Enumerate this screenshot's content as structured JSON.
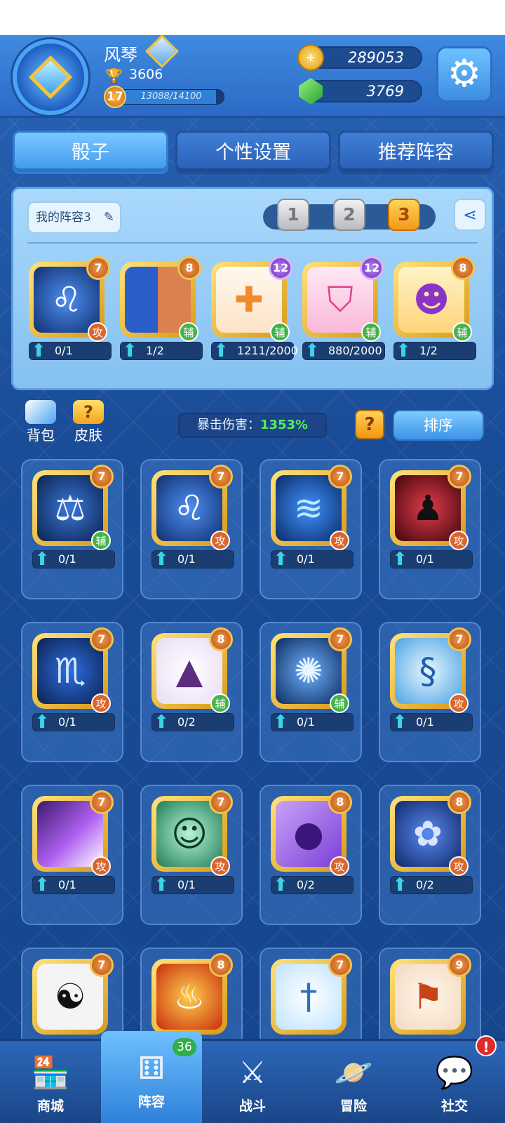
{
  "player": {
    "name": "风琴",
    "trophies": "3606",
    "level": "17",
    "xp_text": "13088/14100",
    "xp_fraction": 0.928
  },
  "currency": {
    "gold": "289053",
    "gems": "3769"
  },
  "tabs": [
    {
      "label": "骰子"
    },
    {
      "label": "个性设置"
    },
    {
      "label": "推荐阵容"
    }
  ],
  "deck": {
    "name": "我的阵容3",
    "slots": [
      "1",
      "2",
      "3"
    ],
    "active_slot": "3",
    "dice": [
      {
        "level": "7",
        "role": "攻",
        "progress": "0/1",
        "icon": "lion-icon"
      },
      {
        "level": "8",
        "role": "辅",
        "progress": "1/2",
        "icon": "half-man-icon"
      },
      {
        "level": "12",
        "role": "辅",
        "progress": "1211/2000",
        "icon": "holy-cross-icon"
      },
      {
        "level": "12",
        "role": "辅",
        "progress": "880/2000",
        "icon": "broken-shield-icon"
      },
      {
        "level": "8",
        "role": "辅",
        "progress": "1/2",
        "icon": "demon-icon"
      }
    ]
  },
  "toolbar": {
    "bag_label": "背包",
    "skin_label": "皮肤",
    "crit_label": "暴击伤害：",
    "crit_value": "1353%",
    "help_label": "?",
    "sort_label": "排序"
  },
  "collection": [
    {
      "level": "7",
      "role": "辅",
      "progress": "0/1",
      "icon": "scales-icon"
    },
    {
      "level": "7",
      "role": "攻",
      "progress": "0/1",
      "icon": "lion-icon"
    },
    {
      "level": "7",
      "role": "攻",
      "progress": "0/1",
      "icon": "wind-swirl-icon"
    },
    {
      "level": "7",
      "role": "攻",
      "progress": "0/1",
      "icon": "vampire-icon"
    },
    {
      "level": "7",
      "role": "攻",
      "progress": "0/1",
      "icon": "scorpion-icon"
    },
    {
      "level": "8",
      "role": "辅",
      "progress": "0/2",
      "icon": "witch-hat-icon"
    },
    {
      "level": "7",
      "role": "辅",
      "progress": "0/1",
      "icon": "dandelion-icon"
    },
    {
      "level": "7",
      "role": "攻",
      "progress": "0/1",
      "icon": "water-dragon-icon"
    },
    {
      "level": "7",
      "role": "攻",
      "progress": "0/1",
      "icon": "light-ray-icon"
    },
    {
      "level": "7",
      "role": "攻",
      "progress": "0/1",
      "icon": "ghost-icon"
    },
    {
      "level": "8",
      "role": "攻",
      "progress": "0/2",
      "icon": "purple-orb-icon"
    },
    {
      "level": "8",
      "role": "攻",
      "progress": "0/2",
      "icon": "lotus-icon"
    },
    {
      "level": "7",
      "role": "",
      "progress": "",
      "icon": "yin-yang-icon"
    },
    {
      "level": "8",
      "role": "",
      "progress": "",
      "icon": "fire-icon"
    },
    {
      "level": "7",
      "role": "",
      "progress": "",
      "icon": "ice-sword-icon"
    },
    {
      "level": "9",
      "role": "",
      "progress": "",
      "icon": "banner-icon"
    }
  ],
  "nav": [
    {
      "label": "商城",
      "icon": "shop-icon"
    },
    {
      "label": "阵容",
      "icon": "dice-icon",
      "badge": "36"
    },
    {
      "label": "战斗",
      "icon": "crossed-swords-icon"
    },
    {
      "label": "冒险",
      "icon": "planet-icon"
    },
    {
      "label": "社交",
      "icon": "chat-icon",
      "alert": "!"
    }
  ]
}
